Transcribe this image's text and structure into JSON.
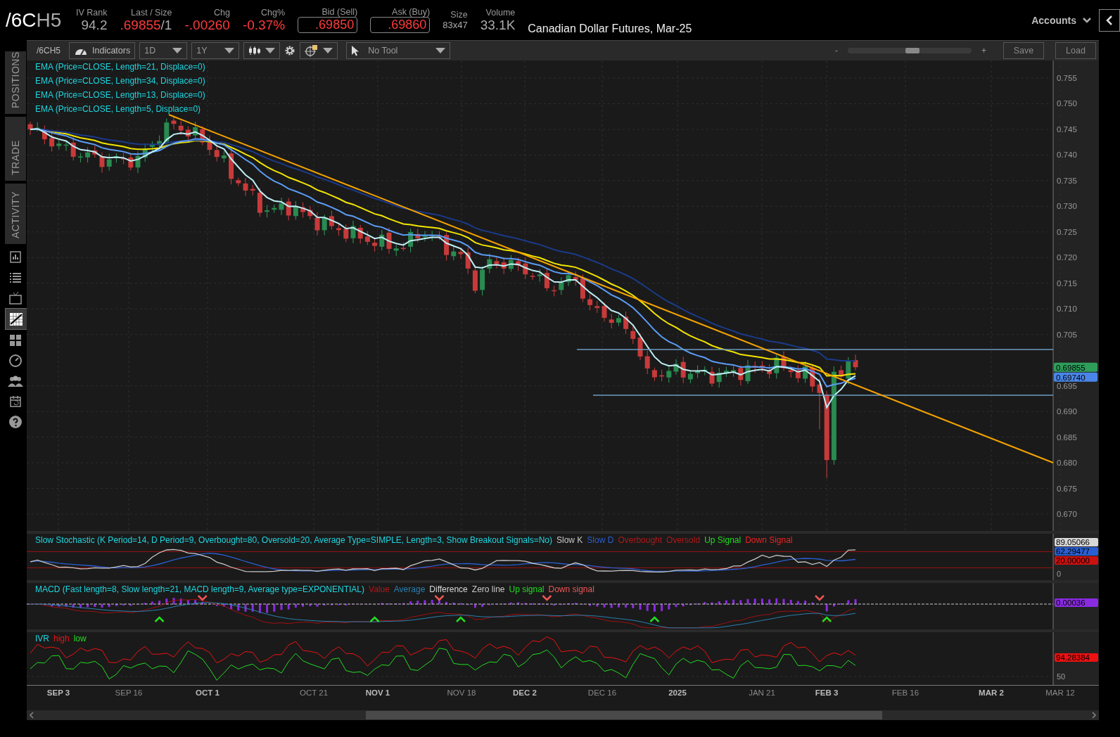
{
  "header": {
    "symbol": "/6C",
    "symbol_suffix": "H5",
    "fields": [
      {
        "label": "IV Rank",
        "value": "94.2",
        "kind": "plain"
      },
      {
        "label": "Last / Size",
        "value": ".69855",
        "suffix": "/1",
        "kind": "last"
      },
      {
        "label": "Chg",
        "value": "-.00260",
        "kind": "negative"
      },
      {
        "label": "Chg%",
        "value": "-0.37%",
        "kind": "negative"
      },
      {
        "label": "Bid (Sell)",
        "value": ".69850",
        "kind": "boxed"
      },
      {
        "label": "Ask (Buy)",
        "value": ".69860",
        "kind": "boxed"
      },
      {
        "label": "Size",
        "value": "83x47",
        "kind": "small"
      },
      {
        "label": "Volume",
        "value": "33.1K",
        "kind": "plain"
      }
    ],
    "description": "Canadian Dollar Futures, Mar-25",
    "accounts": "Accounts"
  },
  "sidebar": {
    "tabs": [
      {
        "label": "POSITIONS"
      },
      {
        "label": "TRADE"
      },
      {
        "label": "ACTIVITY"
      }
    ],
    "icons": [
      {
        "kind": "chart-book",
        "selected": false
      },
      {
        "kind": "list",
        "selected": false
      },
      {
        "kind": "tv",
        "selected": false
      },
      {
        "kind": "chart",
        "selected": true
      },
      {
        "kind": "grid",
        "selected": false
      },
      {
        "kind": "clock",
        "selected": false
      },
      {
        "kind": "people",
        "selected": false
      },
      {
        "kind": "calendar",
        "selected": false
      },
      {
        "kind": "help",
        "selected": false
      }
    ]
  },
  "toolbar": {
    "symbol": "/6CH5",
    "indicators": "Indicators",
    "aggregation": "1D",
    "timeframe": "1Y",
    "tool": "No Tool",
    "zoom_minus": "-",
    "zoom_plus": "+",
    "zoom": {
      "level": 0.52
    },
    "save": "Save",
    "load": "Load"
  },
  "price_chart": {
    "studies": [
      "EMA (Price=CLOSE, Length=21, Displace=0)",
      "EMA (Price=CLOSE, Length=34, Displace=0)",
      "EMA (Price=CLOSE, Length=13, Displace=0)",
      "EMA (Price=CLOSE, Length=5, Displace=0)"
    ],
    "y_ticks": [
      "0.755",
      "0.750",
      "0.745",
      "0.740",
      "0.735",
      "0.730",
      "0.725",
      "0.720",
      "0.715",
      "0.710",
      "0.705",
      "0.695",
      "0.690",
      "0.685",
      "0.680",
      "0.675",
      "0.670"
    ],
    "badges": [
      {
        "value": "0.69855",
        "color": "#2e9e5b"
      },
      {
        "value": "0.69740",
        "color": "#4a86e8"
      }
    ]
  },
  "stochastic": {
    "title": "Slow Stochastic (K Period=14, D Period=9, Overbought=80, Oversold=20, Average Type=SIMPLE, Length=3, Show Breakout Signals=No)",
    "legend": [
      {
        "label": "Slow K",
        "color": "#c8c8c8"
      },
      {
        "label": "Slow D",
        "color": "#2a5fd0"
      },
      {
        "label": "Overbought",
        "color": "#b01818"
      },
      {
        "label": "Oversold",
        "color": "#b01818"
      },
      {
        "label": "Up Signal",
        "color": "#22dd22"
      },
      {
        "label": "Down Signal",
        "color": "#ee2222"
      }
    ],
    "badges": [
      {
        "value": "89.05066",
        "color": "#d8d8d8"
      },
      {
        "value": "62.29477",
        "color": "#2a5fd0"
      },
      {
        "value": "20.00000",
        "color": "#cc1111"
      }
    ],
    "y_tick": "0"
  },
  "macd": {
    "title": "MACD (Fast length=8, Slow length=21, MACD length=9, Average type=EXPONENTIAL)",
    "legend": [
      {
        "label": "Value",
        "color": "#b01818"
      },
      {
        "label": "Average",
        "color": "#2a7fb0"
      },
      {
        "label": "Difference",
        "color": "#d8d8d8"
      },
      {
        "label": "Zero line",
        "color": "#c8c8c8"
      },
      {
        "label": "Up signal",
        "color": "#22dd22"
      },
      {
        "label": "Down signal",
        "color": "#ee5555"
      }
    ],
    "badges": [
      {
        "value": "0.00036",
        "color": "#8a2be2"
      }
    ]
  },
  "ivr": {
    "title": "IVR",
    "legend": [
      {
        "label": "high",
        "color": "#ee1111"
      },
      {
        "label": "low",
        "color": "#22dd22"
      }
    ],
    "badges": [
      {
        "value": "94.28384",
        "color": "#ee1111"
      }
    ],
    "y_tick": "50"
  },
  "x_axis": [
    {
      "label": "SEP 3",
      "bold": true
    },
    {
      "label": "SEP 16",
      "bold": false
    },
    {
      "label": "OCT 1",
      "bold": true
    },
    {
      "label": "OCT 21",
      "bold": false
    },
    {
      "label": "NOV 1",
      "bold": true
    },
    {
      "label": "NOV 18",
      "bold": false
    },
    {
      "label": "DEC 2",
      "bold": true
    },
    {
      "label": "DEC 16",
      "bold": false
    },
    {
      "label": "2025",
      "bold": true
    },
    {
      "label": "JAN 21",
      "bold": false
    },
    {
      "label": "FEB 3",
      "bold": true
    },
    {
      "label": "FEB 16",
      "bold": false
    },
    {
      "label": "MAR 2",
      "bold": true
    },
    {
      "label": "MAR 12",
      "bold": false
    }
  ]
}
